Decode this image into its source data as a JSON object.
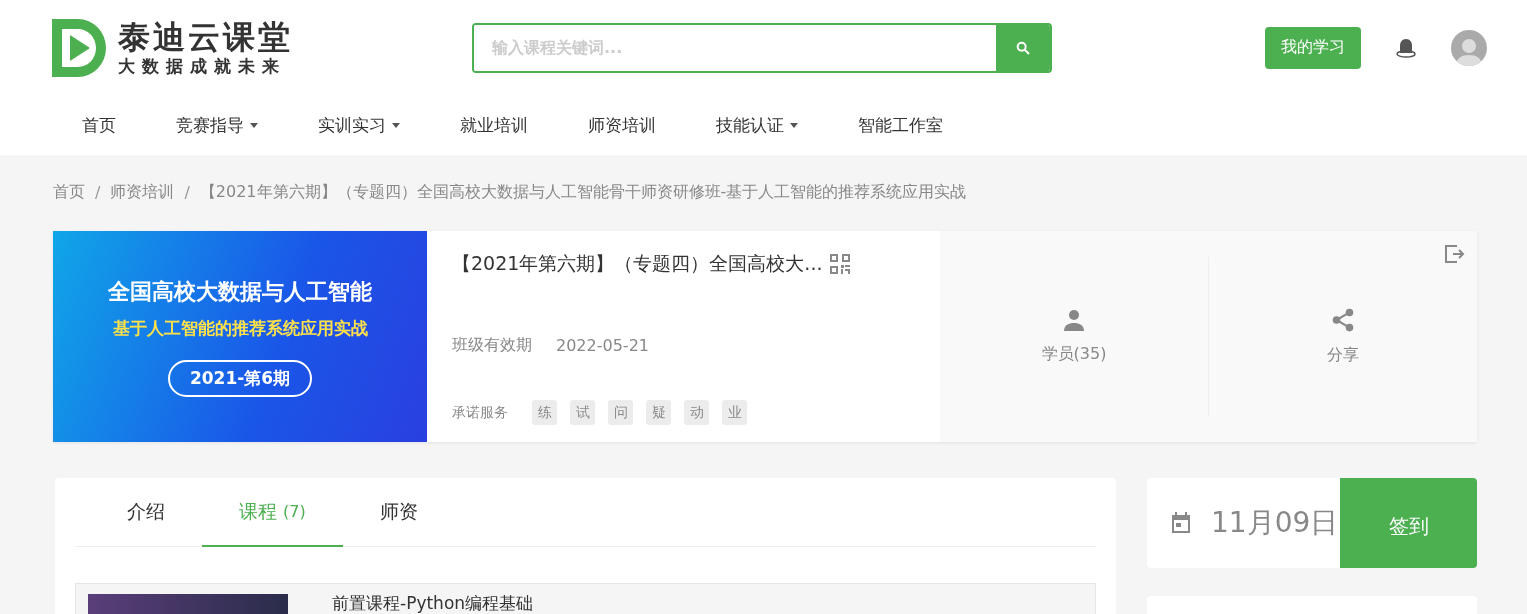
{
  "logo": {
    "title": "泰迪云课堂",
    "slogan": "大数据成就未来"
  },
  "search": {
    "placeholder": "输入课程关键词..."
  },
  "header_actions": {
    "my_learning": "我的学习"
  },
  "nav": [
    {
      "label": "首页",
      "dropdown": false
    },
    {
      "label": "竞赛指导",
      "dropdown": true
    },
    {
      "label": "实训实习",
      "dropdown": true
    },
    {
      "label": "就业培训",
      "dropdown": false
    },
    {
      "label": "师资培训",
      "dropdown": false
    },
    {
      "label": "技能认证",
      "dropdown": true
    },
    {
      "label": "智能工作室",
      "dropdown": false
    }
  ],
  "breadcrumb": [
    {
      "kind": "link",
      "text": "首页"
    },
    {
      "kind": "separator",
      "text": "/"
    },
    {
      "kind": "link",
      "text": "师资培训"
    },
    {
      "kind": "separator",
      "text": "/"
    },
    {
      "kind": "link",
      "text": "【2021年第六期】（专题四）全国高校大数据与人工智能骨干师资研修班-基于人工智能的推荐系统应用实战"
    }
  ],
  "course": {
    "banner": {
      "headline": "全国高校大数据与人工智能",
      "subtitle": "基于人工智能的推荐系统应用实战",
      "badge": "2021-第6期"
    },
    "title": "【2021年第六期】（专题四）全国高校大...",
    "validity_label": "班级有效期",
    "validity_value": "2022-05-21",
    "services_label": "承诺服务",
    "services": [
      "练",
      "试",
      "问",
      "疑",
      "动",
      "业"
    ],
    "stats": [
      {
        "kind": "students",
        "label": "学员(35)"
      },
      {
        "kind": "share",
        "label": "分享"
      }
    ]
  },
  "tabs": [
    {
      "label": "介绍",
      "selected": false
    },
    {
      "label": "课程",
      "count": "(7)",
      "selected": true
    },
    {
      "label": "师资",
      "selected": false
    }
  ],
  "lessons": [
    {
      "title": "前置课程-Python编程基础"
    }
  ],
  "checkin": {
    "date": "11月09日",
    "button": "签到"
  }
}
